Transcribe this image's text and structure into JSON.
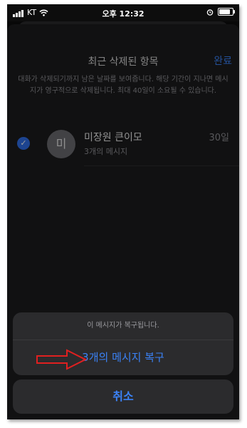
{
  "status_bar": {
    "carrier": "KT",
    "time": "오후 12:32"
  },
  "header": {
    "title": "최근 삭제된 항목",
    "done_label": "완료"
  },
  "notice": "대화가 삭제되기까지 남은 날짜를 보여줍니다. 해당 기간이 지나면 메시지가 영구적으로 삭제됩니다. 최대 40일이 소요될 수 있습니다.",
  "conversation": {
    "avatar_initial": "미",
    "name": "미장원 큰이모",
    "subtitle": "3개의 메시지",
    "days": "30일",
    "selected": true
  },
  "action_sheet": {
    "message": "이 메시지가 복구됩니다.",
    "restore_label": "3개의 메시지 복구",
    "cancel_label": "취소"
  },
  "colors": {
    "accent": "#3b82f6",
    "annotation_arrow": "#e02020"
  },
  "icons": [
    "signal-icon",
    "wifi-icon",
    "alarm-icon",
    "battery-icon",
    "checkmark-icon",
    "arrow-annotation-icon"
  ]
}
